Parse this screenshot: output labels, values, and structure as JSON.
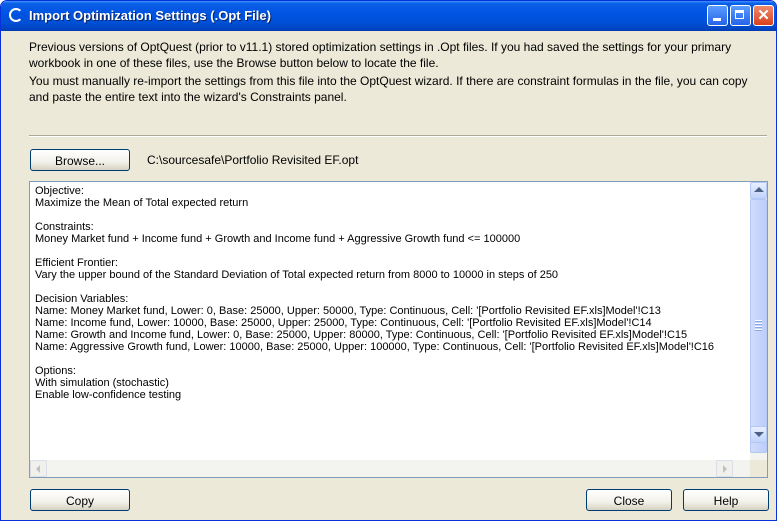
{
  "window": {
    "title": "Import Optimization Settings (.Opt File)"
  },
  "intro": {
    "paragraph1": "Previous versions of OptQuest (prior to v11.1) stored optimization settings in .Opt files. If you had saved the settings for your primary workbook in one of these files, use the Browse button below to locate the file.",
    "paragraph2": "You must manually re-import the settings from this file into the OptQuest wizard. If there are constraint formulas in the file, you can copy and paste the entire text into the wizard's Constraints panel."
  },
  "file": {
    "browse_label": "Browse...",
    "path": "C:\\sourcesafe\\Portfolio Revisited EF.opt"
  },
  "settings_text": {
    "lines": [
      "Objective:",
      "Maximize the Mean of Total expected return",
      "",
      "Constraints:",
      "Money Market fund + Income fund + Growth and Income fund + Aggressive Growth fund <= 100000",
      "",
      "Efficient Frontier:",
      "Vary the upper bound of the Standard Deviation of Total expected return from 8000 to 10000 in steps of 250",
      "",
      "Decision Variables:",
      "Name: Money Market fund, Lower: 0, Base: 25000, Upper: 50000, Type: Continuous, Cell: '[Portfolio Revisited EF.xls]Model'!C13",
      "Name: Income fund, Lower: 10000, Base: 25000, Upper: 25000, Type: Continuous, Cell: '[Portfolio Revisited EF.xls]Model'!C14",
      "Name: Growth and Income fund, Lower: 0, Base: 25000, Upper: 80000, Type: Continuous, Cell: '[Portfolio Revisited EF.xls]Model'!C15",
      "Name: Aggressive Growth fund, Lower: 10000, Base: 25000, Upper: 100000, Type: Continuous, Cell: '[Portfolio Revisited EF.xls]Model'!C16",
      "",
      "Options:",
      "With simulation (stochastic)",
      "Enable low-confidence testing"
    ]
  },
  "buttons": {
    "copy": "Copy",
    "close": "Close",
    "help": "Help"
  },
  "icons": {
    "app": "optquest-logo-icon",
    "minimize": "minimize-icon",
    "maximize": "maximize-icon",
    "close": "close-icon"
  },
  "colors": {
    "titlebar": "#0054e3",
    "dialog_background": "#ece9d8",
    "close_button": "#d8401e"
  }
}
